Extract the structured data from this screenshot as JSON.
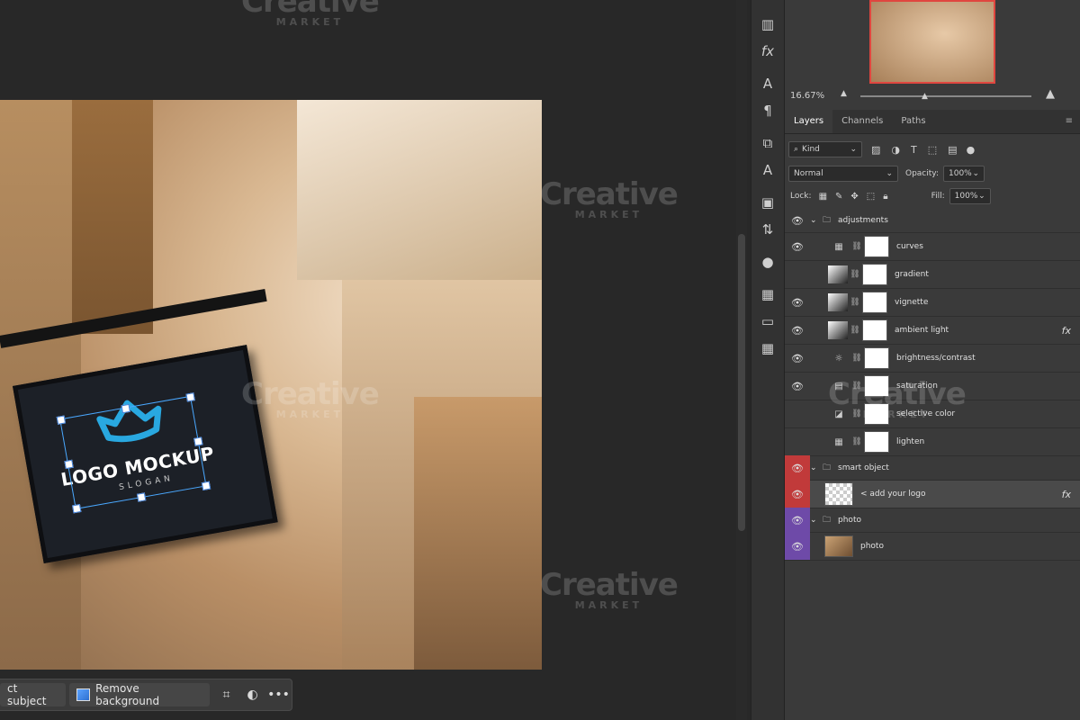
{
  "contextbar": {
    "select_subject": "ct subject",
    "remove_background": "Remove background",
    "more": "•••"
  },
  "canvas": {
    "sign_text": "LOGO MOCKUP",
    "sign_slogan": "SLOGAN"
  },
  "navigator": {
    "zoom": "16.67%"
  },
  "panel_tabs": [
    "Layers",
    "Channels",
    "Paths"
  ],
  "filter": {
    "kind": "Kind"
  },
  "blend": {
    "mode": "Normal",
    "opacity_label": "Opacity:",
    "opacity_value": "100%",
    "lock_label": "Lock:",
    "fill_label": "Fill:",
    "fill_value": "100%"
  },
  "layers": [
    {
      "name": "adjustments",
      "type": "group"
    },
    {
      "name": "curves",
      "type": "adj",
      "visible": true
    },
    {
      "name": "gradient",
      "type": "adj",
      "visible": false
    },
    {
      "name": "vignette",
      "type": "adj",
      "visible": true
    },
    {
      "name": "ambient light",
      "type": "adj",
      "visible": true,
      "fx": "fx"
    },
    {
      "name": "brightness/contrast",
      "type": "adj",
      "visible": true
    },
    {
      "name": "saturation",
      "type": "adj",
      "visible": true
    },
    {
      "name": "selective color",
      "type": "adj",
      "visible": false
    },
    {
      "name": "lighten",
      "type": "adj",
      "visible": false
    },
    {
      "name": "smart object",
      "type": "group",
      "color": "#c13a3a"
    },
    {
      "name": "< add your logo",
      "type": "smart",
      "fx": "fx"
    },
    {
      "name": "photo",
      "type": "group",
      "color": "#6e4aa8"
    },
    {
      "name": "photo",
      "type": "image"
    }
  ],
  "watermark": {
    "word": "Creative",
    "sub": "MARKET"
  },
  "colors": {
    "bg": "#282828",
    "panel": "#3a3a3a",
    "accent_red": "#c13a3a",
    "accent_purple": "#6e4aa8",
    "logo_blue": "#29a8e0"
  }
}
